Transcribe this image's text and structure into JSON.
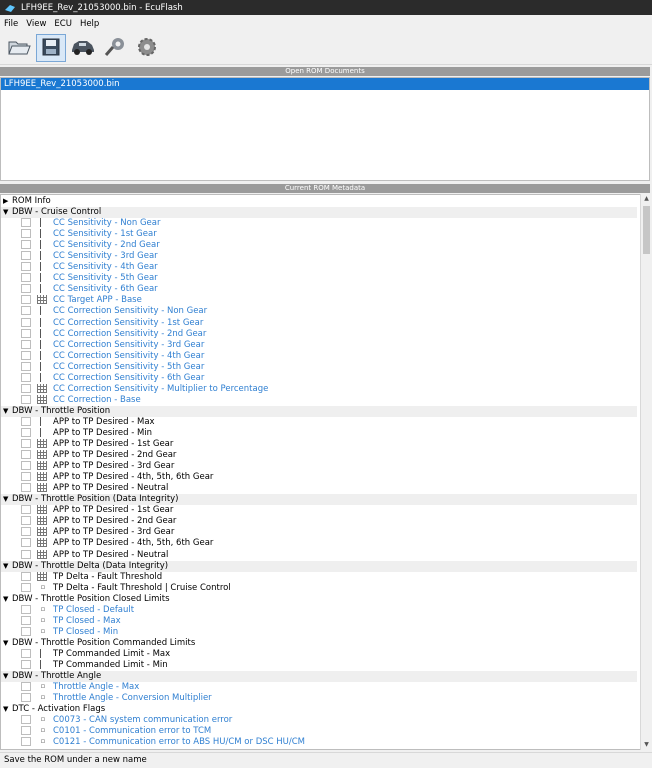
{
  "window": {
    "title": "LFH9EE_Rev_21053000.bin - EcuFlash"
  },
  "menu": [
    "File",
    "View",
    "ECU",
    "Help"
  ],
  "toolbar": {
    "buttons": [
      "open-folder-icon",
      "save-icon",
      "car-icon",
      "tools-icon",
      "settings-gear-icon"
    ]
  },
  "open_rom": {
    "header": "Open ROM Documents",
    "items": [
      "LFH9EE_Rev_21053000.bin"
    ]
  },
  "metadata": {
    "header": "Current ROM Metadata"
  },
  "tree": [
    {
      "type": "cat",
      "collapsed": true,
      "label": "ROM Info"
    },
    {
      "type": "cat",
      "label": "DBW - Cruise Control"
    },
    {
      "type": "item",
      "icon": "v",
      "color": "blue",
      "label": "CC Sensitivity - Non Gear"
    },
    {
      "type": "item",
      "icon": "v",
      "color": "blue",
      "label": "CC Sensitivity - 1st Gear"
    },
    {
      "type": "item",
      "icon": "v",
      "color": "blue",
      "label": "CC Sensitivity - 2nd Gear"
    },
    {
      "type": "item",
      "icon": "v",
      "color": "blue",
      "label": "CC Sensitivity - 3rd Gear"
    },
    {
      "type": "item",
      "icon": "v",
      "color": "blue",
      "label": "CC Sensitivity - 4th Gear"
    },
    {
      "type": "item",
      "icon": "v",
      "color": "blue",
      "label": "CC Sensitivity - 5th Gear"
    },
    {
      "type": "item",
      "icon": "v",
      "color": "blue",
      "label": "CC Sensitivity - 6th Gear"
    },
    {
      "type": "item",
      "icon": "g",
      "color": "blue",
      "label": "CC Target APP - Base"
    },
    {
      "type": "item",
      "icon": "v",
      "color": "blue",
      "label": "CC Correction Sensitivity - Non Gear"
    },
    {
      "type": "item",
      "icon": "v",
      "color": "blue",
      "label": "CC Correction Sensitivity - 1st Gear"
    },
    {
      "type": "item",
      "icon": "v",
      "color": "blue",
      "label": "CC Correction Sensitivity - 2nd Gear"
    },
    {
      "type": "item",
      "icon": "v",
      "color": "blue",
      "label": "CC Correction Sensitivity - 3rd Gear"
    },
    {
      "type": "item",
      "icon": "v",
      "color": "blue",
      "label": "CC Correction Sensitivity - 4th Gear"
    },
    {
      "type": "item",
      "icon": "v",
      "color": "blue",
      "label": "CC Correction Sensitivity - 5th Gear"
    },
    {
      "type": "item",
      "icon": "v",
      "color": "blue",
      "label": "CC Correction Sensitivity - 6th Gear"
    },
    {
      "type": "item",
      "icon": "g",
      "color": "blue",
      "label": "CC Correction Sensitivity - Multiplier to Percentage"
    },
    {
      "type": "item",
      "icon": "g",
      "color": "blue",
      "label": "CC Correction - Base"
    },
    {
      "type": "cat",
      "label": "DBW - Throttle Position"
    },
    {
      "type": "item",
      "icon": "v",
      "color": "black",
      "label": "APP to TP Desired - Max"
    },
    {
      "type": "item",
      "icon": "v",
      "color": "black",
      "label": "APP to TP Desired - Min"
    },
    {
      "type": "item",
      "icon": "g",
      "color": "black",
      "label": "APP to TP Desired - 1st Gear"
    },
    {
      "type": "item",
      "icon": "g",
      "color": "black",
      "label": "APP to TP Desired - 2nd Gear"
    },
    {
      "type": "item",
      "icon": "g",
      "color": "black",
      "label": "APP to TP Desired - 3rd Gear"
    },
    {
      "type": "item",
      "icon": "g",
      "color": "black",
      "label": "APP to TP Desired - 4th, 5th, 6th Gear"
    },
    {
      "type": "item",
      "icon": "g",
      "color": "black",
      "label": "APP to TP Desired - Neutral"
    },
    {
      "type": "cat",
      "label": "DBW - Throttle Position (Data Integrity)"
    },
    {
      "type": "item",
      "icon": "g",
      "color": "black",
      "label": "APP to TP Desired - 1st Gear"
    },
    {
      "type": "item",
      "icon": "g",
      "color": "black",
      "label": "APP to TP Desired - 2nd Gear"
    },
    {
      "type": "item",
      "icon": "g",
      "color": "black",
      "label": "APP to TP Desired - 3rd Gear"
    },
    {
      "type": "item",
      "icon": "g",
      "color": "black",
      "label": "APP to TP Desired - 4th, 5th, 6th Gear"
    },
    {
      "type": "item",
      "icon": "g",
      "color": "black",
      "label": "APP to TP Desired - Neutral"
    },
    {
      "type": "cat",
      "label": "DBW - Throttle Delta (Data Integrity)"
    },
    {
      "type": "item",
      "icon": "g",
      "color": "black",
      "label": "TP Delta - Fault Threshold"
    },
    {
      "type": "item",
      "icon": "d",
      "color": "black",
      "label": "TP Delta - Fault Threshold | Cruise Control"
    },
    {
      "type": "cat",
      "label": "DBW - Throttle Position Closed Limits"
    },
    {
      "type": "item",
      "icon": "d",
      "color": "blue",
      "label": "TP Closed - Default"
    },
    {
      "type": "item",
      "icon": "d",
      "color": "blue",
      "label": "TP Closed - Max"
    },
    {
      "type": "item",
      "icon": "d",
      "color": "blue",
      "label": "TP Closed - Min"
    },
    {
      "type": "cat",
      "label": "DBW - Throttle Position Commanded Limits"
    },
    {
      "type": "item",
      "icon": "v",
      "color": "black",
      "label": "TP Commanded Limit - Max"
    },
    {
      "type": "item",
      "icon": "v",
      "color": "black",
      "label": "TP Commanded Limit - Min"
    },
    {
      "type": "cat",
      "label": "DBW - Throttle Angle"
    },
    {
      "type": "item",
      "icon": "d",
      "color": "blue",
      "label": "Throttle Angle - Max"
    },
    {
      "type": "item",
      "icon": "d",
      "color": "blue",
      "label": "Throttle Angle - Conversion Multiplier"
    },
    {
      "type": "cat",
      "label": "DTC - Activation Flags"
    },
    {
      "type": "item",
      "icon": "d",
      "color": "blue",
      "label": "C0073 - CAN system communication error"
    },
    {
      "type": "item",
      "icon": "d",
      "color": "blue",
      "label": "C0101 - Communication error to TCM"
    },
    {
      "type": "item",
      "icon": "d",
      "color": "blue",
      "label": "C0121 - Communication error to ABS HU/CM or DSC HU/CM"
    }
  ],
  "status": "Save the ROM under a new name",
  "colors": {
    "selection": "#1a78d2",
    "link_blue": "#2f7fd1",
    "titlebar": "#2b2b2b"
  }
}
